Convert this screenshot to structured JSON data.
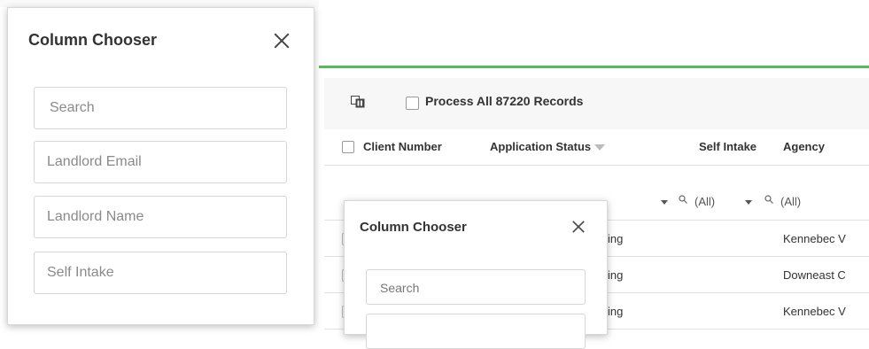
{
  "grid": {
    "process_label": "Process All 87220 Records",
    "columns": [
      {
        "label": "Client Number"
      },
      {
        "label": "Application Status"
      },
      {
        "label": "Self Intake"
      },
      {
        "label": "Agency"
      }
    ],
    "filters": [
      {
        "value": "(All)"
      },
      {
        "value": "(All)"
      }
    ],
    "rows": [
      {
        "status": "ing",
        "agency": "Kennebec V"
      },
      {
        "status": "ing",
        "agency": "Downeast C"
      },
      {
        "status": "ing",
        "agency": "Kennebec V"
      }
    ]
  },
  "chooser_large": {
    "title": "Column Chooser",
    "search_placeholder": "Search",
    "items": [
      "Landlord Email",
      "Landlord Name",
      "Self Intake"
    ]
  },
  "chooser_small": {
    "title": "Column Chooser",
    "search_placeholder": "Search"
  },
  "colors": {
    "accent_green": "#5cb85c",
    "toolbar_bg": "#f7f7f7",
    "border": "#e2e2e2"
  },
  "icons": [
    "column-chooser-icon",
    "close-icon",
    "filter-icon",
    "search-icon",
    "chevron-down-icon"
  ]
}
